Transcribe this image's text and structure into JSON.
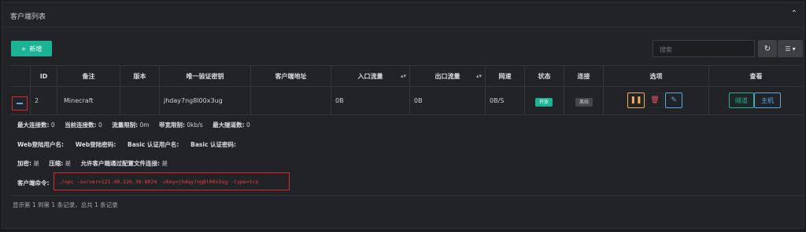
{
  "panel": {
    "title": "客户端列表",
    "collapse_icon": "chevron-up-icon",
    "close_icon": "close-icon"
  },
  "toolbar": {
    "new_label": "新增",
    "new_icon": "plus-icon",
    "search_placeholder": "搜索",
    "refresh_icon": "refresh-icon",
    "columns_icon": "columns-icon"
  },
  "table": {
    "headers": {
      "id": "ID",
      "remark": "备注",
      "version": "版本",
      "vkey": "唯一验证密钥",
      "addr": "客户端地址",
      "inlet": "入口流量",
      "outlet": "出口流量",
      "speed": "网速",
      "status": "状态",
      "conn": "连接",
      "options": "选项",
      "view": "查看"
    },
    "row": {
      "id": "2",
      "remark": "Minecraft",
      "version": "",
      "vkey": "jhday7ng8l00x3ug",
      "addr": "",
      "inlet": "0B",
      "outlet": "0B",
      "speed": "0B/S",
      "status": "开放",
      "conn": "离线",
      "btn_tunnel": "隧道",
      "btn_host": "主机"
    }
  },
  "detail": {
    "line1": [
      {
        "label": "最大连接数:",
        "value": "0"
      },
      {
        "label": "当前连接数:",
        "value": "0"
      },
      {
        "label": "流量限制:",
        "value": "0m"
      },
      {
        "label": "带宽限制:",
        "value": "0kb/s"
      },
      {
        "label": "最大隧道数:",
        "value": "0"
      }
    ],
    "line2": [
      {
        "label": "Web登陆用户名:",
        "value": ""
      },
      {
        "label": "Web登陆密码:",
        "value": ""
      },
      {
        "label": "Basic 认证用户名:",
        "value": ""
      },
      {
        "label": "Basic 认证密码:",
        "value": ""
      }
    ],
    "line3": [
      {
        "label": "加密:",
        "value": "是"
      },
      {
        "label": "压缩:",
        "value": "是"
      },
      {
        "label": "允许客户端通过配置文件连接:",
        "value": "是"
      }
    ],
    "cmd_label": "客户端命令:",
    "cmd": "./npc -server=121.40.226.38:8024 -vkey=jhday7ng8l00x3ug -type=tcp"
  },
  "footer": "显示第 1 到第 1 条记录，总共 1 条记录",
  "colors": {
    "accent": "#1ab394",
    "danger": "#e0262b",
    "info": "#5aa8e0",
    "warning": "#f8ac59"
  }
}
